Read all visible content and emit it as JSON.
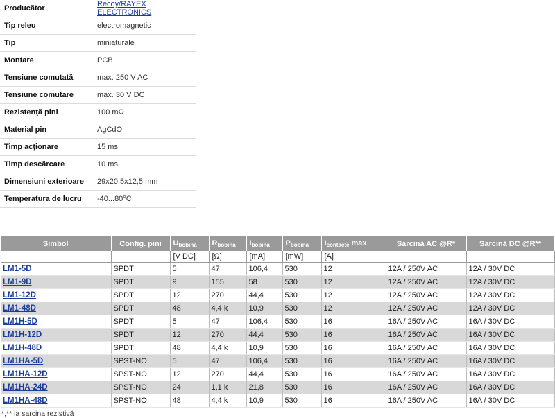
{
  "specs": [
    {
      "label": "Producător",
      "value": "Recoy/RAYEX ELECTRONICS",
      "link": true
    },
    {
      "label": "Tip releu",
      "value": "electromagnetic"
    },
    {
      "label": "Tip",
      "value": "miniaturale"
    },
    {
      "label": "Montare",
      "value": "PCB"
    },
    {
      "label": "Tensiune comutată",
      "value": "max. 250 V AC"
    },
    {
      "label": "Tensiune comutare",
      "value": "max. 30 V DC"
    },
    {
      "label": "Rezistenţă pini",
      "value": "100 mΩ"
    },
    {
      "label": "Material pin",
      "value": "AgCdO"
    },
    {
      "label": "Timp acţionare",
      "value": "15 ms"
    },
    {
      "label": "Timp descărcare",
      "value": "10 ms"
    },
    {
      "label": "Dimensiuni exterioare",
      "value": "29x20,5x12,5 mm"
    },
    {
      "label": "Temperatura de lucru",
      "value": "-40...80°C"
    }
  ],
  "table": {
    "headers": {
      "symbol": "Simbol",
      "config": "Config. pini",
      "u_main": "U",
      "u_sub": "bobină",
      "r_main": "R",
      "r_sub": "bobină",
      "i_main": "I",
      "i_sub": "bobină",
      "p_main": "P",
      "p_sub": "bobină",
      "ic_main": "I",
      "ic_sub": "contacte",
      "ic_suffix": " max",
      "ac": "Sarcină AC @R*",
      "dc": "Sarcină DC @R**"
    },
    "units": {
      "u": "[V DC]",
      "r": "[Ω]",
      "i": "[mA]",
      "p": "[mW]",
      "ic": "[A]"
    },
    "rows": [
      {
        "symbol": "LM1-5D",
        "config": "SPDT",
        "u": "5",
        "r": "47",
        "i": "106,4",
        "p": "530",
        "ic": "12",
        "ac": "12A / 250V AC",
        "dc": "12A / 30V DC"
      },
      {
        "symbol": "LM1-9D",
        "config": "SPDT",
        "u": "9",
        "r": "155",
        "i": "58",
        "p": "530",
        "ic": "12",
        "ac": "12A / 250V AC",
        "dc": "12A / 30V DC"
      },
      {
        "symbol": "LM1-12D",
        "config": "SPDT",
        "u": "12",
        "r": "270",
        "i": "44,4",
        "p": "530",
        "ic": "12",
        "ac": "12A / 250V AC",
        "dc": "12A / 30V DC"
      },
      {
        "symbol": "LM1-48D",
        "config": "SPDT",
        "u": "48",
        "r": "4,4 k",
        "i": "10,9",
        "p": "530",
        "ic": "12",
        "ac": "12A / 250V AC",
        "dc": "12A / 30V DC"
      },
      {
        "symbol": "LM1H-5D",
        "config": "SPDT",
        "u": "5",
        "r": "47",
        "i": "106,4",
        "p": "530",
        "ic": "16",
        "ac": "16A / 250V AC",
        "dc": "16A / 30V DC"
      },
      {
        "symbol": "LM1H-12D",
        "config": "SPDT",
        "u": "12",
        "r": "270",
        "i": "44,4",
        "p": "530",
        "ic": "16",
        "ac": "16A / 250V AC",
        "dc": "16A / 30V DC"
      },
      {
        "symbol": "LM1H-48D",
        "config": "SPDT",
        "u": "48",
        "r": "4,4 k",
        "i": "10,9",
        "p": "530",
        "ic": "16",
        "ac": "16A / 250V AC",
        "dc": "16A / 30V DC"
      },
      {
        "symbol": "LM1HA-5D",
        "config": "SPST-NO",
        "u": "5",
        "r": "47",
        "i": "106,4",
        "p": "530",
        "ic": "16",
        "ac": "16A / 250V AC",
        "dc": "16A / 30V DC"
      },
      {
        "symbol": "LM1HA-12D",
        "config": "SPST-NO",
        "u": "12",
        "r": "270",
        "i": "44,4",
        "p": "530",
        "ic": "16",
        "ac": "16A / 250V AC",
        "dc": "16A / 30V DC"
      },
      {
        "symbol": "LM1HA-24D",
        "config": "SPST-NO",
        "u": "24",
        "r": "1,1 k",
        "i": "21,8",
        "p": "530",
        "ic": "16",
        "ac": "16A / 250V AC",
        "dc": "16A / 30V DC"
      },
      {
        "symbol": "LM1HA-48D",
        "config": "SPST-NO",
        "u": "48",
        "r": "4,4 k",
        "i": "10,9",
        "p": "530",
        "ic": "16",
        "ac": "16A / 250V AC",
        "dc": "16A / 30V DC"
      }
    ]
  },
  "footnote": "*,** la sarcina rezistivă"
}
